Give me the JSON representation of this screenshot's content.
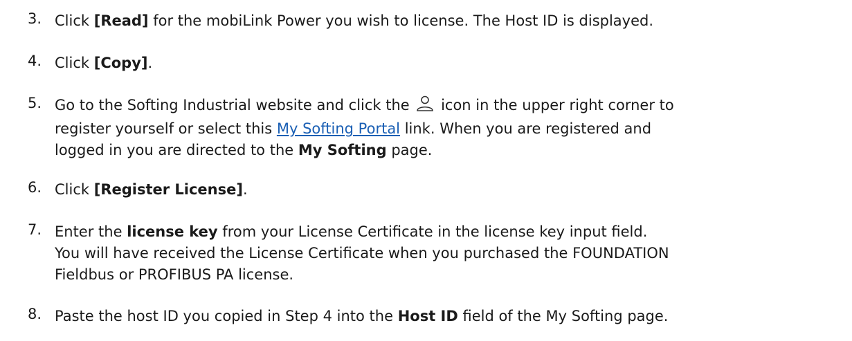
{
  "steps": [
    {
      "num": "3.",
      "pre": "Click ",
      "bold": "[Read]",
      "post": " for the mobiLink Power you wish to license. The Host ID is displayed."
    },
    {
      "num": "4.",
      "pre": "Click ",
      "bold": "[Copy]",
      "post": "."
    },
    {
      "num": "5.",
      "line1_pre": "Go to the Softing Industrial website and click the ",
      "icon": "user-icon",
      "line1_post": " icon in the upper right corner to",
      "line2_pre": "register yourself or select this ",
      "link": "My Softing Portal",
      "line2_post": " link. When you are registered and",
      "line3_pre": "logged in you are directed to the ",
      "line3_bold": "My Softing",
      "line3_post": " page."
    },
    {
      "num": "6.",
      "pre": "Click ",
      "bold": "[Register License]",
      "post": "."
    },
    {
      "num": "7.",
      "line1_pre": "Enter the ",
      "line1_bold": "license key",
      "line1_post": " from your License Certificate in the license key input field.",
      "line2": "You will have received the License Certificate when you purchased the FOUNDATION",
      "line3": "Fieldbus or PROFIBUS PA license."
    },
    {
      "num": "8.",
      "pre": "Paste the host ID you copied in Step 4 into the ",
      "bold": "Host ID",
      "post": " field of the My Softing page."
    }
  ],
  "colors": {
    "link": "#1a5fb4",
    "text": "#1a1a1a"
  }
}
